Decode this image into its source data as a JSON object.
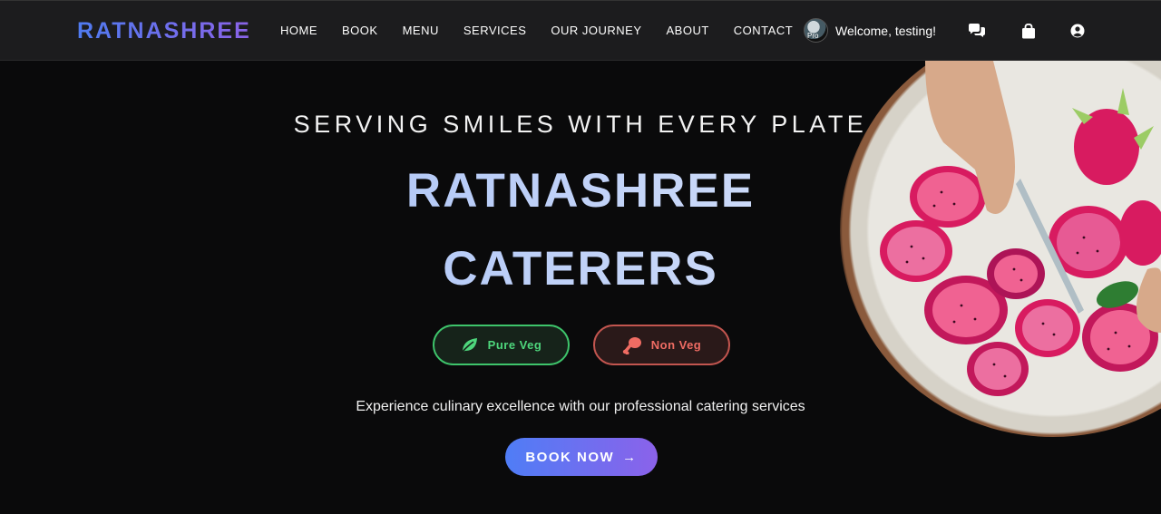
{
  "navbar": {
    "brand": "RATNASHREE",
    "links": [
      "HOME",
      "BOOK",
      "MENU",
      "SERVICES",
      "OUR JOURNEY",
      "ABOUT",
      "CONTACT"
    ],
    "avatar_alt": "Pro",
    "welcome": "Welcome, testing!",
    "icons": [
      "chat-icon",
      "shopping-bag-icon",
      "user-circle-icon"
    ]
  },
  "hero": {
    "tagline": "SERVING SMILES WITH EVERY PLATE",
    "title_line1": "RATNASHREE",
    "title_line2": "CATERERS",
    "veg_label": "Pure Veg",
    "nonveg_label": "Non Veg",
    "subtitle": "Experience culinary excellence with our professional catering services",
    "cta_label": "BOOK NOW",
    "cta_arrow": "→"
  },
  "colors": {
    "brand_gradient_start": "#4f7bf0",
    "brand_gradient_end": "#8b63e8",
    "veg": "#3ec46b",
    "nonveg": "#c2554f",
    "background": "#0a0a0b"
  }
}
